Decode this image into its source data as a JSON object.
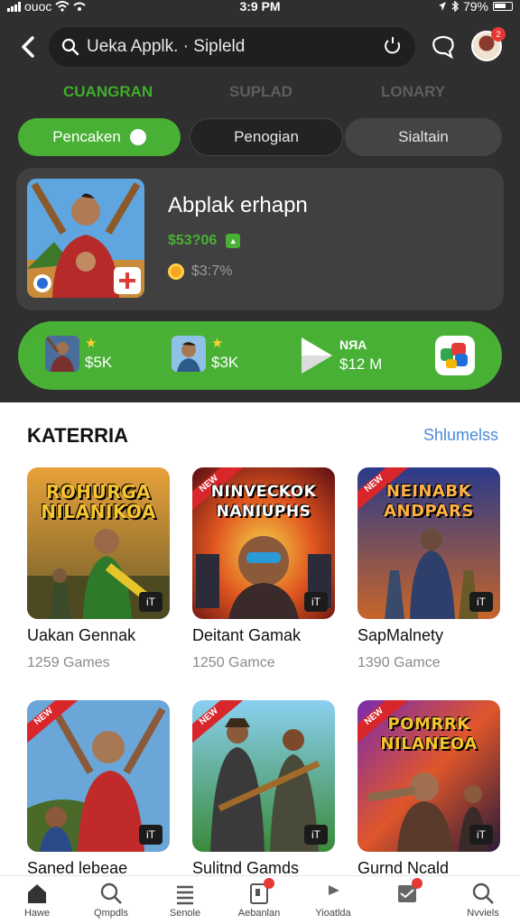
{
  "status_bar": {
    "carrier": "ouoc",
    "time": "3:9 PM",
    "battery": "79%"
  },
  "search": {
    "value": "Ueka Applk. · Sipleld"
  },
  "notification_badge": "2",
  "tabs": [
    {
      "label": "CUANGRAN",
      "active": true
    },
    {
      "label": "SUPLAD",
      "active": false
    },
    {
      "label": "LONARY",
      "active": false
    }
  ],
  "chips": [
    {
      "label": "Pencaken",
      "selected": true
    },
    {
      "label": "Penogian",
      "selected": false
    },
    {
      "label": "Sialtain",
      "selected": false
    }
  ],
  "featured": {
    "title": "Abplak erhapn",
    "price": "$53?06",
    "price_alt": "$3:7%"
  },
  "promo_bar": {
    "items": [
      {
        "value": "$5K"
      },
      {
        "value": "$3K"
      },
      {
        "label": "NЯA",
        "value": "$12 M"
      }
    ]
  },
  "section": {
    "title": "KATERRIA",
    "link": "Shlumelss"
  },
  "cards": [
    {
      "name": "Uakan Gennak",
      "count": "1259 Games",
      "logo": "ROHURGA NILANIKOA",
      "ribbon": ""
    },
    {
      "name": "Deitant Gamak",
      "count": "1250 Gamce",
      "logo": "NINVECKOK NANIUPHS",
      "ribbon": "NEW"
    },
    {
      "name": "SapMalnety",
      "count": "1390 Gamce",
      "logo": "NEINABK ANDPARS",
      "ribbon": "NEW"
    },
    {
      "name": "Saned lebeae",
      "count": "",
      "logo": "",
      "ribbon": "NEW"
    },
    {
      "name": "Sulitnd Gamds",
      "count": "",
      "logo": "",
      "ribbon": "NEW"
    },
    {
      "name": "Gurnd Ncald",
      "count": "",
      "logo": "POMRRK NILANEOA",
      "ribbon": "NEW"
    }
  ],
  "card_corner_label": "iT",
  "bottom_nav": [
    {
      "label": "Hawe",
      "icon": "home-icon"
    },
    {
      "label": "Qmpdls",
      "icon": "search-icon"
    },
    {
      "label": "Senole",
      "icon": "list-icon"
    },
    {
      "label": "Aebanlan",
      "icon": "document-icon"
    },
    {
      "label": "Yioatlda",
      "icon": "flag-icon"
    },
    {
      "label": "",
      "icon": "inbox-icon"
    },
    {
      "label": "Nvviels",
      "icon": "search-icon"
    }
  ],
  "colors": {
    "accent_green": "#48b035",
    "dark_bg": "#2f2f2f",
    "link_blue": "#4a8bd8"
  }
}
